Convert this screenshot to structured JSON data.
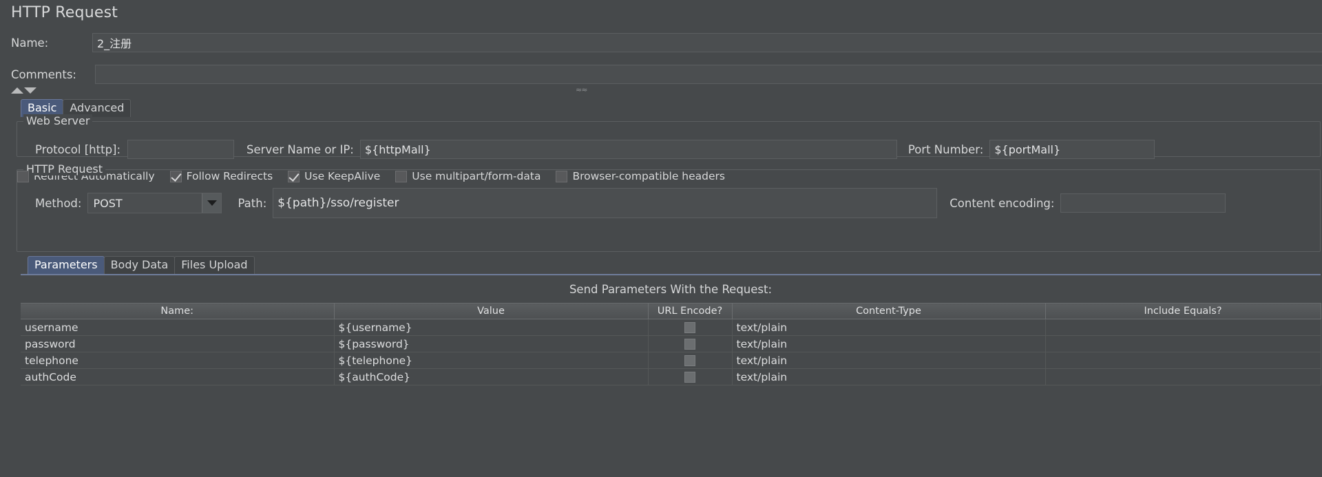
{
  "header": {
    "title": "HTTP Request",
    "name_label": "Name:",
    "name_value": "2_注册",
    "comments_label": "Comments:",
    "comments_value": ""
  },
  "outer_tabs": [
    {
      "label": "Basic",
      "active": true
    },
    {
      "label": "Advanced",
      "active": false
    }
  ],
  "web_server": {
    "group_title": "Web Server",
    "protocol_label": "Protocol [http]:",
    "protocol_value": "",
    "server_label": "Server Name or IP:",
    "server_value": "${httpMall}",
    "port_label": "Port Number:",
    "port_value": "${portMall}"
  },
  "http_request": {
    "group_title": "HTTP Request",
    "method_label": "Method:",
    "method_value": "POST",
    "path_label": "Path:",
    "path_value": "${path}/sso/register",
    "encoding_label": "Content encoding:",
    "encoding_value": "",
    "checkboxes": [
      {
        "label": "Redirect Automatically",
        "checked": false
      },
      {
        "label": "Follow Redirects",
        "checked": true
      },
      {
        "label": "Use KeepAlive",
        "checked": true
      },
      {
        "label": "Use multipart/form-data",
        "checked": false
      },
      {
        "label": "Browser-compatible headers",
        "checked": false
      }
    ]
  },
  "inner_tabs": [
    {
      "label": "Parameters",
      "active": true
    },
    {
      "label": "Body Data",
      "active": false
    },
    {
      "label": "Files Upload",
      "active": false
    }
  ],
  "parameters_panel": {
    "title": "Send Parameters With the Request:",
    "columns": [
      "Name:",
      "Value",
      "URL Encode?",
      "Content-Type",
      "Include Equals?"
    ],
    "rows": [
      {
        "name": "username",
        "value": "${username}",
        "url_encode": false,
        "content_type": "text/plain",
        "include_equals": ""
      },
      {
        "name": "password",
        "value": "${password}",
        "url_encode": false,
        "content_type": "text/plain",
        "include_equals": ""
      },
      {
        "name": "telephone",
        "value": "${telephone}",
        "url_encode": false,
        "content_type": "text/plain",
        "include_equals": ""
      },
      {
        "name": "authCode",
        "value": "${authCode}",
        "url_encode": false,
        "content_type": "text/plain",
        "include_equals": ""
      }
    ]
  },
  "colors": {
    "background": "#46494b",
    "accent_tab": "#4a5a7a",
    "field_bg": "#4b4e50",
    "border": "#5c5f61",
    "text": "#d6d7d8"
  }
}
